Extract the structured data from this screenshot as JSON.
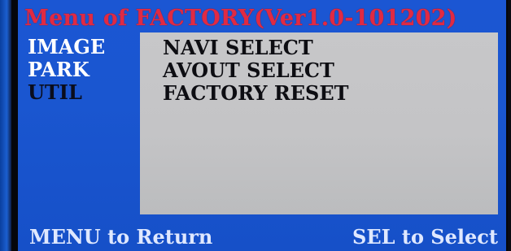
{
  "title": "Menu of  FACTORY(Ver1.0-101202)",
  "side_menu": {
    "items": [
      {
        "label": "IMAGE",
        "state": "normal"
      },
      {
        "label": "PARK",
        "state": "active"
      },
      {
        "label": "UTIL",
        "state": "inactive"
      }
    ]
  },
  "panel": {
    "items": [
      {
        "label": "NAVI SELECT"
      },
      {
        "label": "AVOUT SELECT"
      },
      {
        "label": "FACTORY RESET"
      }
    ]
  },
  "footer": {
    "left_hint": "MENU to Return",
    "right_hint": "SEL to Select"
  },
  "colors": {
    "screen_bg": "#1a56d0",
    "title": "#e02a43",
    "panel_bg": "#c4c4c6",
    "menu_text_active": "#ffffff",
    "menu_text_inactive": "#0a0d1c",
    "panel_text": "#0d0d12",
    "footer_text": "#dfe8ff"
  }
}
